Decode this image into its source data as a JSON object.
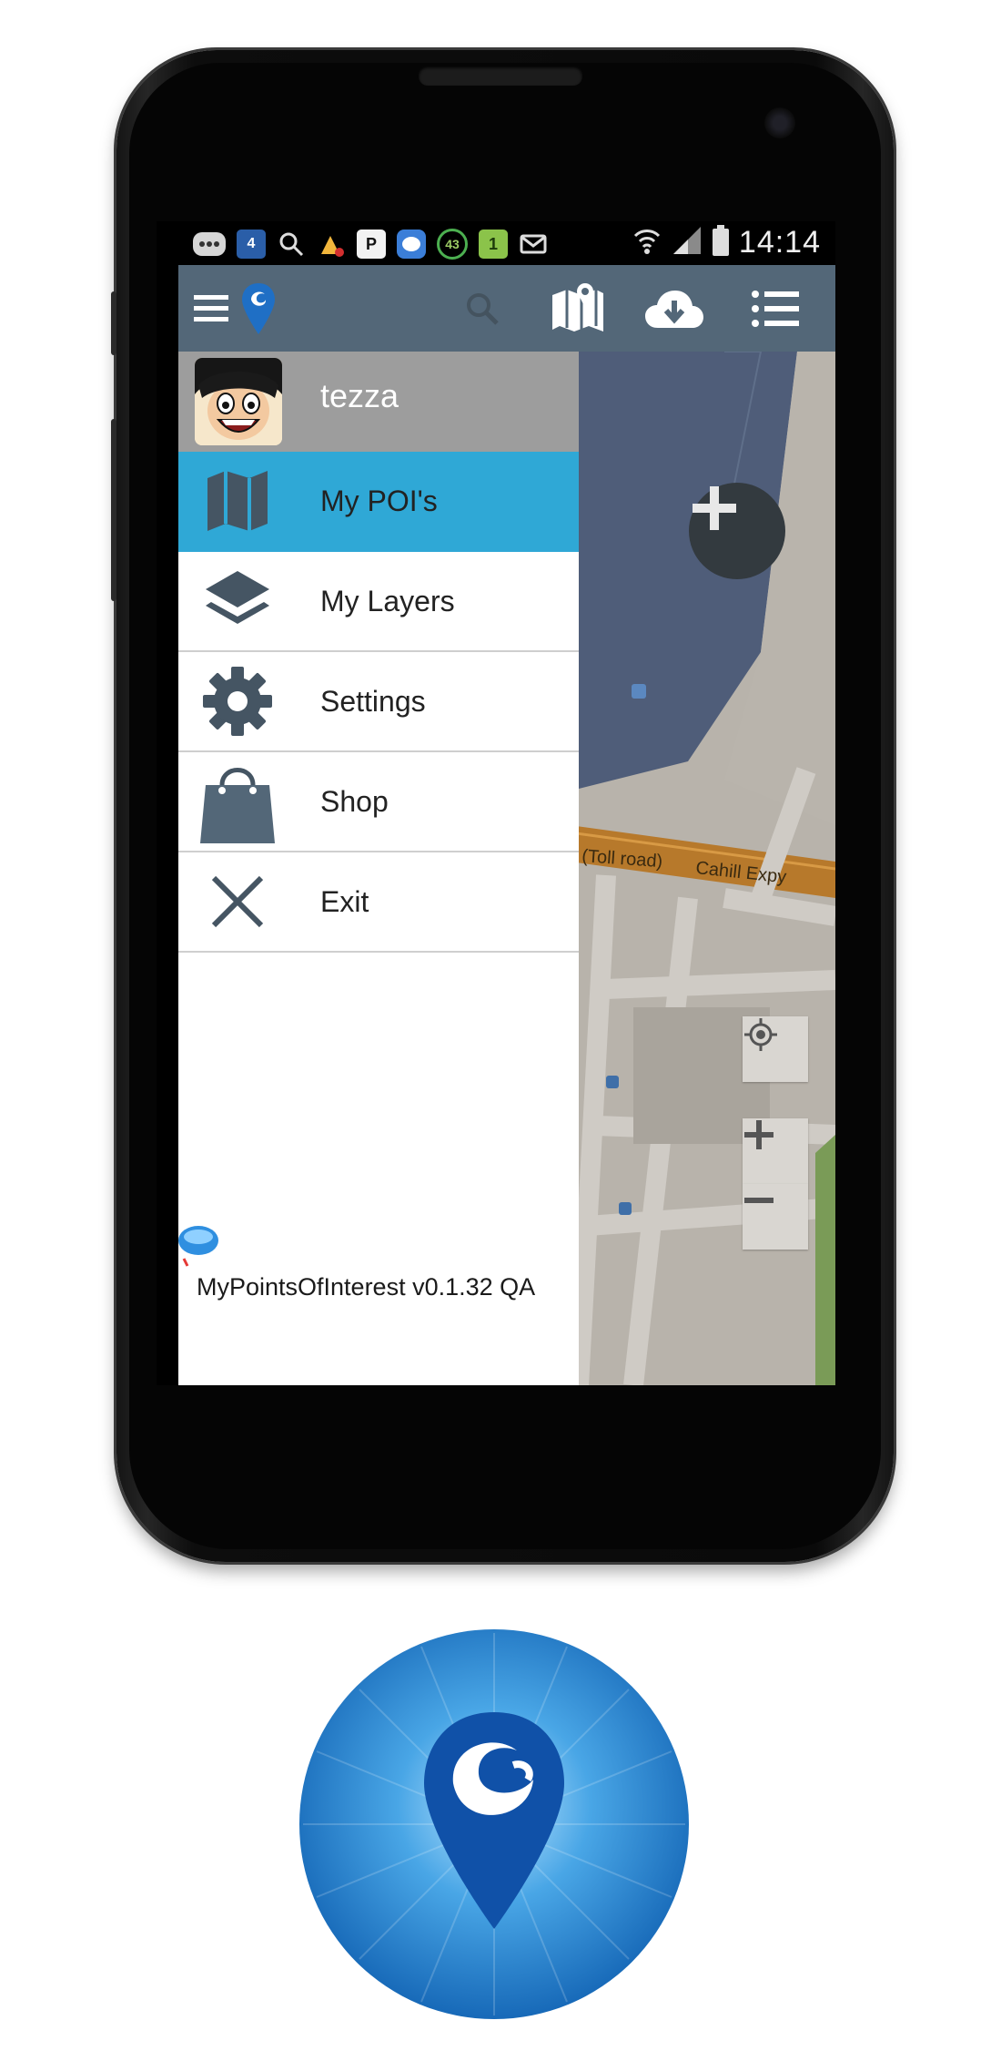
{
  "status_bar": {
    "time": "14:14",
    "icons": [
      "chat-icon",
      "calendar-icon",
      "search-icon",
      "alert-icon",
      "p-icon",
      "messenger-icon",
      "badge-43-icon",
      "sim-1-icon",
      "mail-icon",
      "wifi-icon",
      "signal-icon",
      "battery-icon"
    ],
    "calendar_day": "4",
    "badge_count": "43",
    "sim_label": "1"
  },
  "toolbar": {
    "icons": [
      "hamburger-icon",
      "app-pin-icon",
      "search-icon",
      "map-icon",
      "cloud-download-icon",
      "list-icon"
    ],
    "color": "#536778"
  },
  "drawer": {
    "user_name": "tezza",
    "items": [
      {
        "label": "My POI's",
        "icon": "map-icon",
        "active": true
      },
      {
        "label": "My Layers",
        "icon": "layers-icon",
        "active": false
      },
      {
        "label": "Settings",
        "icon": "gear-icon",
        "active": false
      },
      {
        "label": "Shop",
        "icon": "shopping-bag-icon",
        "active": false
      },
      {
        "label": "Exit",
        "icon": "close-icon",
        "active": false
      }
    ],
    "version": "MyPointsOfInterest v0.1.32 QA",
    "accent": "#2fa8d6"
  },
  "map": {
    "road_labels": [
      "(Toll road)",
      "Cahill Expy"
    ],
    "controls": [
      "add-poi-button",
      "my-location-button",
      "zoom-in-button",
      "zoom-out-button"
    ]
  }
}
